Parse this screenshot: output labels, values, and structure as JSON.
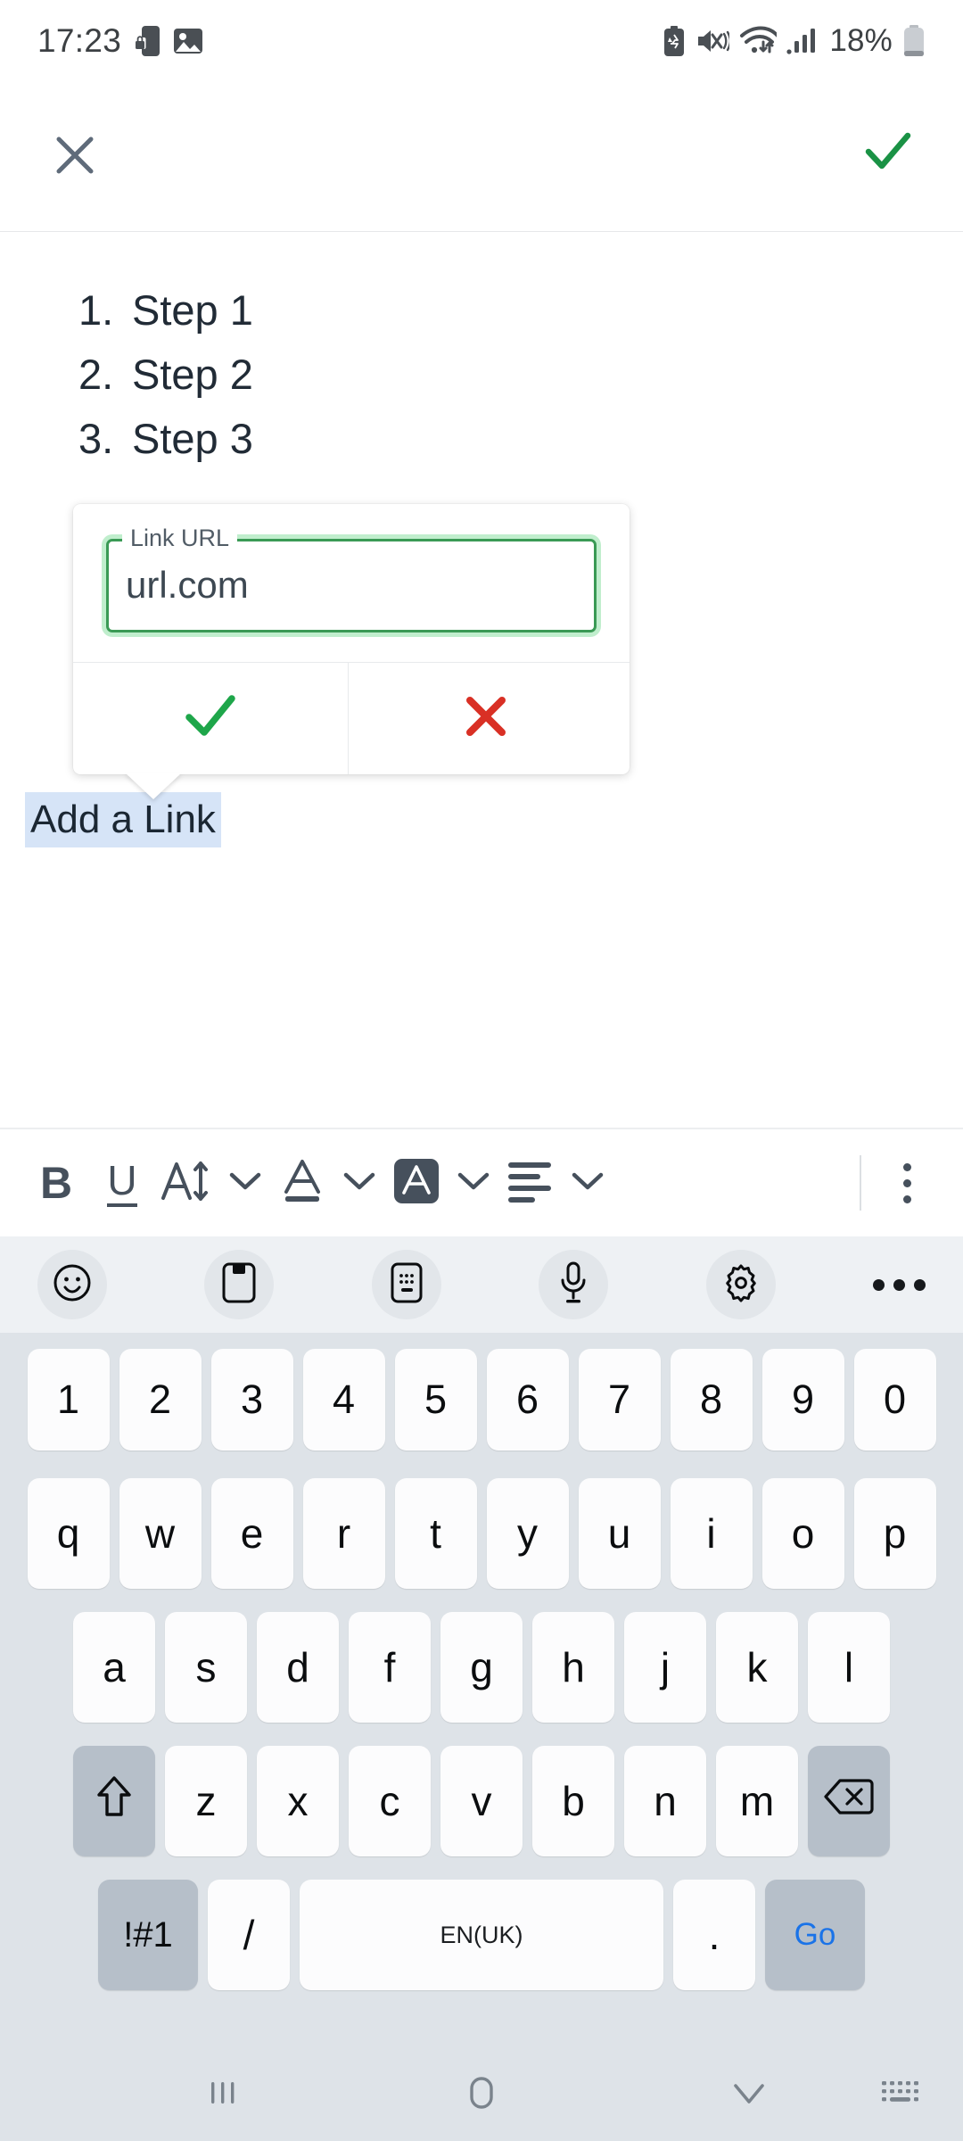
{
  "status_bar": {
    "time": "17:23",
    "battery_percent": "18%",
    "left_icons": [
      "phone-lock-icon",
      "image-icon"
    ],
    "right_icons": [
      "battery-saver-icon",
      "mute-vibrate-icon",
      "wifi-icon",
      "signal-bars-icon",
      "battery-icon"
    ]
  },
  "app_bar": {
    "close_icon": "close-icon",
    "done_icon": "check-icon",
    "done_color": "#1a9245",
    "close_color": "#5f6b7a"
  },
  "editor": {
    "list_items": [
      {
        "number": "1.",
        "text": "Step 1"
      },
      {
        "number": "2.",
        "text": "Step 2"
      },
      {
        "number": "3.",
        "text": "Step 3"
      }
    ],
    "selected_text": "Add a Link",
    "selection_color": "#d6e4f7"
  },
  "link_popup": {
    "field_label": "Link URL",
    "field_value": "url.com",
    "field_placeholder": "Link URL",
    "accent_color": "#3a9a55",
    "confirm_icon": "check-icon",
    "cancel_icon": "close-icon",
    "confirm_color": "#1ea64a",
    "cancel_color": "#d93025"
  },
  "format_toolbar": {
    "bold_label": "B",
    "underline_label": "U",
    "items": [
      {
        "name": "bold",
        "icon": "bold-icon"
      },
      {
        "name": "underline",
        "icon": "underline-icon"
      },
      {
        "name": "font-size",
        "icon": "font-size-icon"
      },
      {
        "name": "font-size-dropdown",
        "icon": "chevron-down-icon"
      },
      {
        "name": "text-color",
        "icon": "text-color-icon"
      },
      {
        "name": "text-color-dropdown",
        "icon": "chevron-down-icon"
      },
      {
        "name": "highlight-color",
        "icon": "highlight-color-icon"
      },
      {
        "name": "highlight-color-dropdown",
        "icon": "chevron-down-icon"
      },
      {
        "name": "align",
        "icon": "align-left-icon"
      },
      {
        "name": "align-dropdown",
        "icon": "chevron-down-icon"
      },
      {
        "name": "overflow",
        "icon": "more-vertical-icon"
      }
    ],
    "icon_color": "#46505c"
  },
  "keyboard": {
    "toolbar_icons": [
      "emoji-icon",
      "clipboard-icon",
      "handwriting-icon",
      "microphone-icon",
      "settings-gear-icon",
      "more-horizontal-icon"
    ],
    "rows": {
      "numbers": [
        "1",
        "2",
        "3",
        "4",
        "5",
        "6",
        "7",
        "8",
        "9",
        "0"
      ],
      "top": [
        "q",
        "w",
        "e",
        "r",
        "t",
        "y",
        "u",
        "i",
        "o",
        "p"
      ],
      "home": [
        "a",
        "s",
        "d",
        "f",
        "g",
        "h",
        "j",
        "k",
        "l"
      ],
      "bottom": [
        "z",
        "x",
        "c",
        "v",
        "b",
        "n",
        "m"
      ]
    },
    "shift_icon": "shift-icon",
    "backspace_icon": "backspace-icon",
    "symbols_label": "!#1",
    "slash_label": "/",
    "space_label": "EN(UK)",
    "period_label": ".",
    "go_label": "Go",
    "go_text_color": "#1a73e8",
    "background_color": "#dee3e8",
    "key_color": "#fcfcfd",
    "mod_key_color": "#b6bfc9"
  },
  "nav_bar": {
    "recents_icon": "recents-icon",
    "home_icon": "home-icon",
    "hide_keyboard_icon": "chevron-down-icon",
    "switch_keyboard_icon": "keyboard-icon",
    "icon_color": "#7a838c"
  }
}
